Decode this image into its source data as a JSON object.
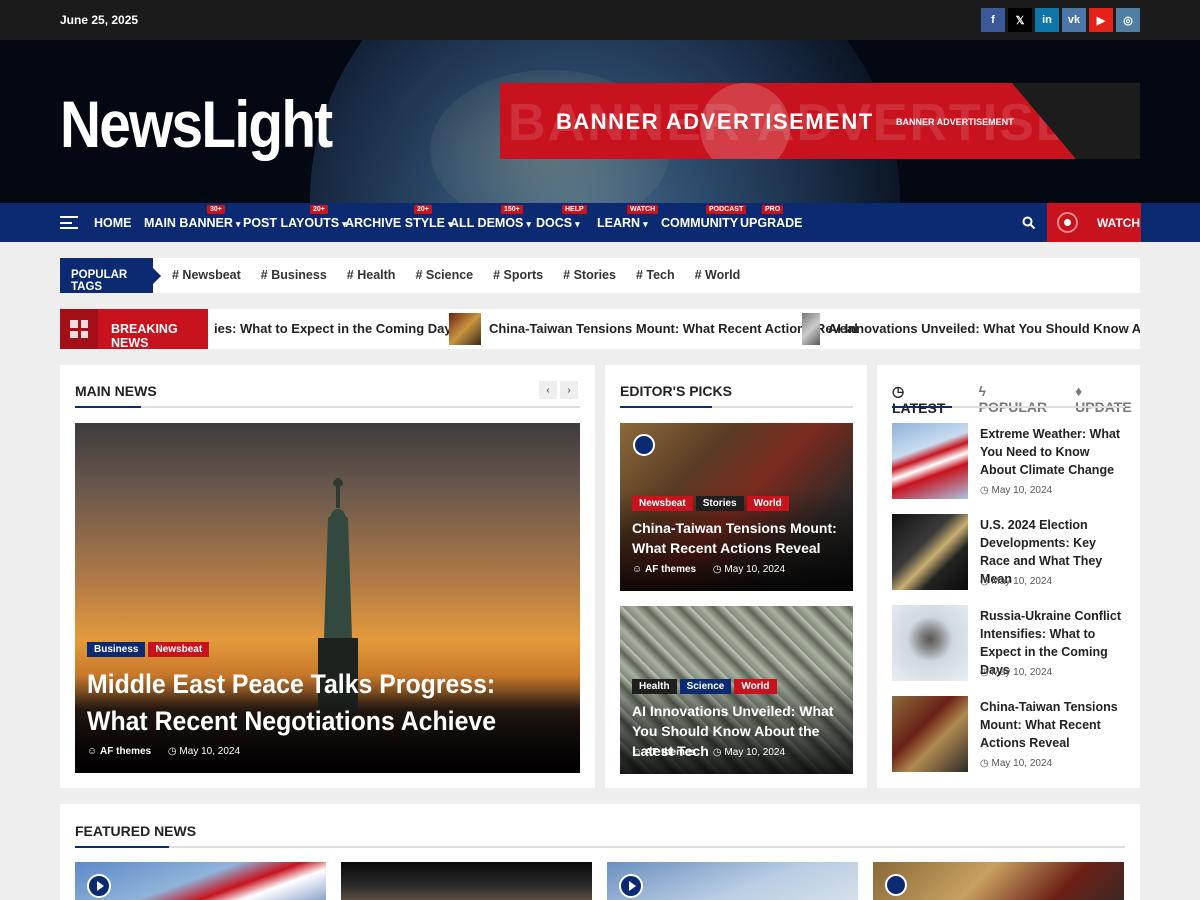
{
  "topbar": {
    "date": "June 25, 2025",
    "socials": [
      {
        "name": "facebook-icon",
        "glyph": "f",
        "color": "#3b5998"
      },
      {
        "name": "x-icon",
        "glyph": "𝕏",
        "color": "#000000"
      },
      {
        "name": "linkedin-icon",
        "glyph": "in",
        "color": "#0e76a8"
      },
      {
        "name": "vk-icon",
        "glyph": "vk",
        "color": "#4a76a8"
      },
      {
        "name": "youtube-icon",
        "glyph": "▶",
        "color": "#e62117"
      },
      {
        "name": "instagram-icon",
        "glyph": "◎",
        "color": "#517fa4"
      }
    ]
  },
  "header": {
    "logo": "NewsLight",
    "banner_main": "BANNER ADVERTISEMENT",
    "banner_ghost": "BANNER ADVERTISEME",
    "banner_small": "BANNER ADVERTISEMENT"
  },
  "nav": {
    "items": [
      {
        "label": "HOME",
        "badge": ""
      },
      {
        "label": "MAIN BANNER",
        "badge": "30+"
      },
      {
        "label": "POST LAYOUTS",
        "badge": "20+"
      },
      {
        "label": "ARCHIVE STYLE",
        "badge": "20+"
      },
      {
        "label": "ALL DEMOS",
        "badge": "150+"
      },
      {
        "label": "DOCS",
        "badge": "HELP"
      },
      {
        "label": "LEARN",
        "badge": "WATCH"
      },
      {
        "label": "COMMUNITY",
        "badge": "PODCAST"
      },
      {
        "label": "UPGRADE",
        "badge": "PRO"
      }
    ],
    "watch": "WATCH"
  },
  "popular_tags": {
    "label": "POPULAR TAGS",
    "tags": [
      "# Newsbeat",
      "# Business",
      "# Health",
      "# Science",
      "# Sports",
      "# Stories",
      "# Tech",
      "# World"
    ]
  },
  "breaking": {
    "label": "BREAKING NEWS",
    "items": [
      "ies: What to Expect in the Coming Days",
      "China-Taiwan Tensions Mount: What Recent Actions Reveal",
      "AI Innovations Unveiled: What You Should Know About the L"
    ]
  },
  "main_news": {
    "title": "MAIN NEWS",
    "prev": "‹",
    "next": "›",
    "cats": [
      "Business",
      "Newsbeat"
    ],
    "headline": "Middle East Peace Talks Progress: What Recent Negotiations Achieve",
    "author": "AF themes",
    "date": "May 10, 2024"
  },
  "editors_picks": {
    "title": "EDITOR'S PICKS",
    "cards": [
      {
        "cats": [
          "Newsbeat",
          "Stories",
          "World"
        ],
        "title": "China-Taiwan Tensions Mount: What Recent Actions Reveal",
        "author": "AF themes",
        "date": "May 10, 2024"
      },
      {
        "cats": [
          "Health",
          "Science",
          "World"
        ],
        "title": "AI Innovations Unveiled: What You Should Know About the Latest Tech",
        "author": "AF themes",
        "date": "May 10, 2024"
      }
    ]
  },
  "latest": {
    "tabs": [
      "LATEST",
      "POPULAR",
      "UPDATE"
    ],
    "items": [
      {
        "title": "Extreme Weather: What You Need to Know About Climate Change",
        "date": "May 10, 2024"
      },
      {
        "title": "U.S. 2024 Election Developments: Key Race and What They Mean",
        "date": "May 10, 2024"
      },
      {
        "title": "Russia-Ukraine Conflict Intensifies: What to Expect in the Coming Days",
        "date": "May 10, 2024"
      },
      {
        "title": "China-Taiwan Tensions Mount: What Recent Actions Reveal",
        "date": "May 10, 2024"
      }
    ]
  },
  "featured": {
    "title": "FEATURED NEWS"
  },
  "colors": {
    "primary": "#0b2a72",
    "accent": "#c8131e",
    "topbar": "#1b1b1b"
  }
}
